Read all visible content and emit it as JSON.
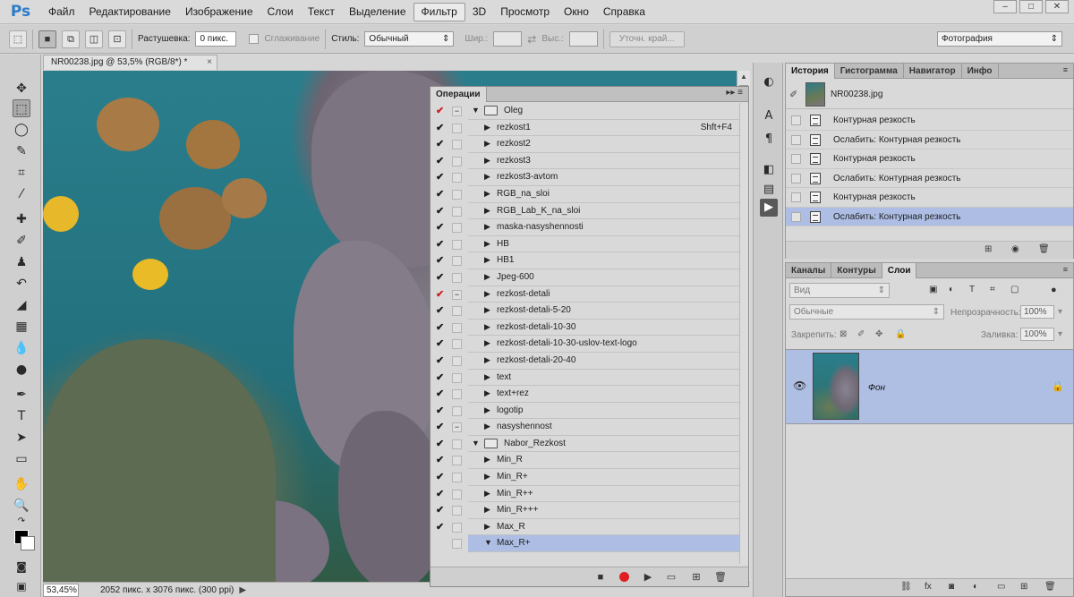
{
  "app": {
    "logo": "Ps"
  },
  "menu": [
    "Файл",
    "Редактирование",
    "Изображение",
    "Слои",
    "Текст",
    "Выделение",
    "Фильтр",
    "3D",
    "Просмотр",
    "Окно",
    "Справка"
  ],
  "options": {
    "feather_label": "Растушевка:",
    "feather_value": "0 пикс.",
    "antialias_label": "Сглаживание",
    "style_label": "Стиль:",
    "style_value": "Обычный",
    "width_label": "Шир.:",
    "height_label": "Выс.:",
    "refine_edge": "Уточн. край...",
    "workspace": "Фотография"
  },
  "document": {
    "tab_title": "NR00238.jpg @ 53,5% (RGB/8*) *",
    "zoom": "53,45%",
    "info": "2052 пикс. x 3076 пикс. (300 ppi)"
  },
  "actions_panel": {
    "title": "Операции",
    "rows": [
      {
        "check": "red",
        "dialog": "−",
        "kind": "set",
        "expanded": true,
        "name": "Oleg",
        "key": ""
      },
      {
        "check": "black",
        "dialog": "",
        "kind": "action",
        "expanded": false,
        "name": "rezkost1",
        "key": "Shft+F4"
      },
      {
        "check": "black",
        "dialog": "",
        "kind": "action",
        "expanded": false,
        "name": "rezkost2",
        "key": ""
      },
      {
        "check": "black",
        "dialog": "",
        "kind": "action",
        "expanded": false,
        "name": "rezkost3",
        "key": ""
      },
      {
        "check": "black",
        "dialog": "",
        "kind": "action",
        "expanded": false,
        "name": "rezkost3-avtom",
        "key": ""
      },
      {
        "check": "black",
        "dialog": "",
        "kind": "action",
        "expanded": false,
        "name": "RGB_na_sloi",
        "key": ""
      },
      {
        "check": "black",
        "dialog": "",
        "kind": "action",
        "expanded": false,
        "name": "RGB_Lab_K_na_sloi",
        "key": ""
      },
      {
        "check": "black",
        "dialog": "",
        "kind": "action",
        "expanded": false,
        "name": "maska-nasyshennosti",
        "key": ""
      },
      {
        "check": "black",
        "dialog": "",
        "kind": "action",
        "expanded": false,
        "name": "HB",
        "key": ""
      },
      {
        "check": "black",
        "dialog": "",
        "kind": "action",
        "expanded": false,
        "name": "HB1",
        "key": ""
      },
      {
        "check": "black",
        "dialog": "",
        "kind": "action",
        "expanded": false,
        "name": "Jpeg-600",
        "key": ""
      },
      {
        "check": "red",
        "dialog": "−",
        "kind": "action",
        "expanded": false,
        "name": "rezkost-detali",
        "key": ""
      },
      {
        "check": "black",
        "dialog": "",
        "kind": "action",
        "expanded": false,
        "name": "rezkost-detali-5-20",
        "key": ""
      },
      {
        "check": "black",
        "dialog": "",
        "kind": "action",
        "expanded": false,
        "name": "rezkost-detali-10-30",
        "key": ""
      },
      {
        "check": "black",
        "dialog": "",
        "kind": "action",
        "expanded": false,
        "name": "rezkost-detali-10-30-uslov-text-logo",
        "key": ""
      },
      {
        "check": "black",
        "dialog": "",
        "kind": "action",
        "expanded": false,
        "name": "rezkost-detali-20-40",
        "key": ""
      },
      {
        "check": "black",
        "dialog": "",
        "kind": "action",
        "expanded": false,
        "name": "text",
        "key": ""
      },
      {
        "check": "black",
        "dialog": "",
        "kind": "action",
        "expanded": false,
        "name": "text+rez",
        "key": ""
      },
      {
        "check": "black",
        "dialog": "",
        "kind": "action",
        "expanded": false,
        "name": "logotip",
        "key": ""
      },
      {
        "check": "black",
        "dialog": "−",
        "kind": "action",
        "expanded": false,
        "name": "nasyshennost",
        "key": ""
      },
      {
        "check": "black",
        "dialog": "",
        "kind": "set",
        "expanded": true,
        "name": "Nabor_Rezkost",
        "key": ""
      },
      {
        "check": "black",
        "dialog": "",
        "kind": "action",
        "expanded": false,
        "name": "Min_R",
        "key": ""
      },
      {
        "check": "black",
        "dialog": "",
        "kind": "action",
        "expanded": false,
        "name": "Min_R+",
        "key": ""
      },
      {
        "check": "black",
        "dialog": "",
        "kind": "action",
        "expanded": false,
        "name": "Min_R++",
        "key": ""
      },
      {
        "check": "black",
        "dialog": "",
        "kind": "action",
        "expanded": false,
        "name": "Min_R+++",
        "key": ""
      },
      {
        "check": "black",
        "dialog": "",
        "kind": "action",
        "expanded": false,
        "name": "Max_R",
        "key": ""
      },
      {
        "check": "none",
        "dialog": "",
        "kind": "action",
        "expanded": true,
        "name": "Max_R+",
        "key": "",
        "selected": true
      }
    ]
  },
  "history_panel": {
    "tabs": [
      "История",
      "Гистограмма",
      "Навигатор",
      "Инфо"
    ],
    "snapshot": "NR00238.jpg",
    "items": [
      {
        "label": "Контурная резкость",
        "selected": false
      },
      {
        "label": "Ослабить: Контурная резкость",
        "selected": false
      },
      {
        "label": "Контурная резкость",
        "selected": false
      },
      {
        "label": "Ослабить: Контурная резкость",
        "selected": false
      },
      {
        "label": "Контурная резкость",
        "selected": false
      },
      {
        "label": "Ослабить: Контурная резкость",
        "selected": true
      }
    ]
  },
  "layers_panel": {
    "tabs": [
      "Каналы",
      "Контуры",
      "Слои"
    ],
    "kind_filter": "Вид",
    "blend_mode": "Обычные",
    "opacity_label": "Непрозрачность:",
    "opacity": "100%",
    "lock_label": "Закрепить:",
    "fill_label": "Заливка:",
    "fill": "100%",
    "layer_name": "Фон"
  }
}
